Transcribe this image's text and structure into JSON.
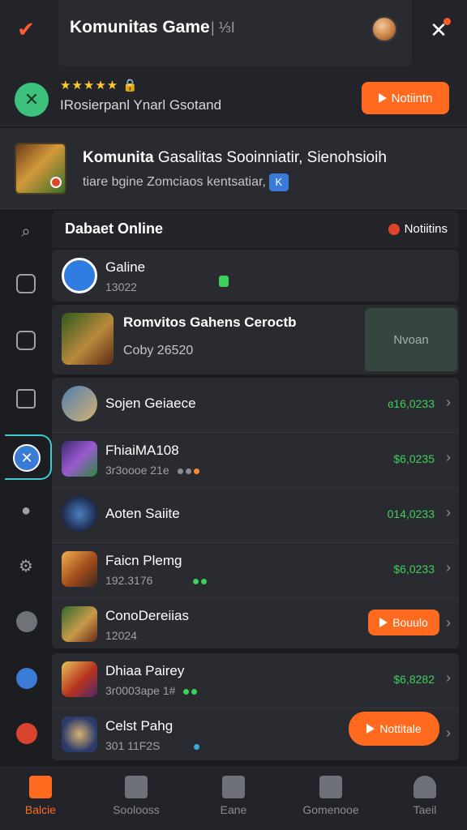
{
  "header": {
    "title": "Komunitas Game",
    "title_suffix": "| ⅓I",
    "back_icon": "check-chevron-icon",
    "close_icon": "close-x-icon"
  },
  "rating": {
    "stars": "★★★★★",
    "subline": "IRosierpanl Ynarl Gsotand",
    "notify_label": "Notiintn"
  },
  "feature": {
    "title_bold": "Komunita",
    "title_rest": "Gasalitas Sooinniatir, Sienohsioih",
    "subtitle": "tiare bgine Zomciaos kentsatiar,",
    "tag": "K"
  },
  "section": {
    "title": "Dabaet Online",
    "right_label": "Notiitins"
  },
  "rows": [
    {
      "name": "Galine",
      "meta": "13022"
    },
    {
      "name": "Romvitos Gahens Ceroctb",
      "meta": "Coby 26520",
      "action": "Nvoan"
    }
  ],
  "list": [
    {
      "name": "Sojen Geiaece",
      "meta": "",
      "price": "ɞ16,0233"
    },
    {
      "name": "FhiaiMA108",
      "meta": "3r3oooe 21e",
      "price": "$6,0235"
    },
    {
      "name": "Aoten Saiite",
      "meta": "",
      "price": "014,0233"
    },
    {
      "name": "Faicn Plemg",
      "meta": "192.3176",
      "price": "$6,0233"
    },
    {
      "name": "ConoDereiias",
      "meta": "12024",
      "action": "Bouulo"
    },
    {
      "name": "Dhiaa Pairey",
      "meta": "3r0003ape 1#",
      "price": "$6,8282"
    },
    {
      "name": "Celst Pahg",
      "meta": "301 11F2S",
      "action": "Nottitale"
    }
  ],
  "bottom_nav": [
    {
      "label": "Balcie"
    },
    {
      "label": "Soolooss"
    },
    {
      "label": "Eane"
    },
    {
      "label": "Gomenooe"
    },
    {
      "label": "Taeil"
    }
  ],
  "colors": {
    "accent": "#ff6a1f",
    "price": "#3fcf5b",
    "active_ring": "#3ec9d0"
  }
}
